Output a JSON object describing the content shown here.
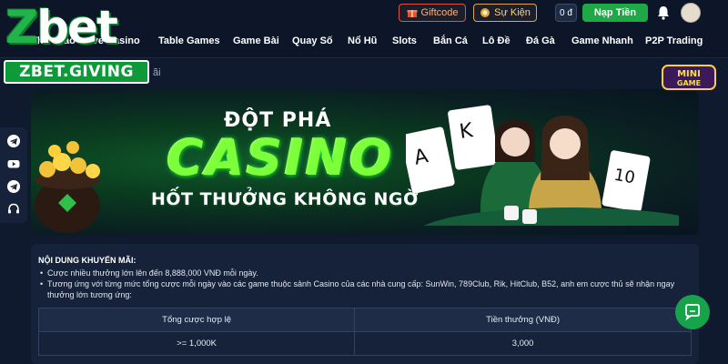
{
  "brand": {
    "logo_text": "Zbet",
    "badge": "ZBET.GIVING"
  },
  "header": {
    "giftcode_label": "Giftcode",
    "sukien_label": "Sự Kiện",
    "balance": "0 đ",
    "deposit_label": "Nạp Tiền"
  },
  "nav": {
    "items": [
      {
        "label": "Thể Thao"
      },
      {
        "label": "Live Casino"
      },
      {
        "label": "Table Games"
      },
      {
        "label": "Game Bài"
      },
      {
        "label": "Quay Số"
      },
      {
        "label": "Nổ Hũ"
      },
      {
        "label": "Slots"
      },
      {
        "label": "Bắn Cá"
      },
      {
        "label": "Lô Đề"
      },
      {
        "label": "Đá Gà"
      },
      {
        "label": "Game Nhanh"
      },
      {
        "label": "P2P Trading"
      }
    ]
  },
  "breadcrumb": "ãi",
  "social_icons": [
    "telegram-icon",
    "youtube-icon",
    "telegram-icon",
    "headset-icon"
  ],
  "banner": {
    "line1": "ĐỘT PHÁ",
    "line2": "CASINO",
    "line3": "HỐT THƯỞNG KHÔNG NGỜ",
    "minigame_label": "MINI GAME"
  },
  "content": {
    "heading": "NỘI DUNG KHUYẾN MÃI:",
    "bullets": [
      "Cược nhiều thưởng lớn lên đến 8,888,000 VNĐ mỗi ngày.",
      "Tương ứng với từng mức tổng cược mỗi ngày vào các game thuộc sảnh Casino của các nhà cung cấp: SunWin, 789Club, Rik, HitClub, B52, anh em cược thủ sẽ nhận ngay thưởng lớn tương ứng:"
    ],
    "table": {
      "headers": [
        "Tổng cược hợp lệ",
        "Tiền thưởng (VNĐ)"
      ],
      "rows": [
        [
          "&gt;= 1,000K",
          "3,000"
        ]
      ]
    }
  },
  "colors": {
    "accent_green": "#1fa846",
    "bg": "#0f1a2e",
    "panel": "#16223a"
  }
}
